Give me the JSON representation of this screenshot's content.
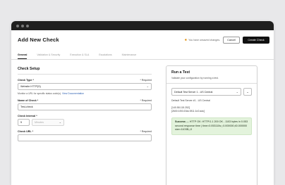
{
  "header": {
    "title": "Add New Check",
    "unsaved_text": "You have unsaved changes.",
    "cancel_label": "Cancel",
    "create_label": "Create Check"
  },
  "tabs": [
    {
      "label": "General",
      "active": true
    },
    {
      "label": "Validation & Security",
      "active": false
    },
    {
      "label": "Execution & SLA",
      "active": false
    },
    {
      "label": "Escalations",
      "active": false
    },
    {
      "label": "Maintenance",
      "active": false
    }
  ],
  "setup": {
    "title": "Check Setup",
    "check_type_label": "Check Type *",
    "check_type_required": "* Required",
    "check_type_value": "Website HTTP(S)",
    "check_type_help": "Monitor a URL for specific status code(s).",
    "check_type_help_link": "View Documentation",
    "name_label": "Name of Check *",
    "name_required": "* Required",
    "name_value": "Test-check",
    "interval_label": "Check Interval *",
    "interval_value": "5",
    "interval_unit": "Minutes",
    "url_label": "Check URL *",
    "url_required": "* Required"
  },
  "run_test": {
    "title": "Run a Test",
    "subtitle": "Validate your configuration by running a test.",
    "server_value": "Default Test Server 1 - US Central",
    "server_name": "Default Test Server #1 - US Central",
    "server_ipv4": "[140.58.115.252]",
    "server_ipv6": "[2600:1f00:20dc:5f11:1e2:adc]",
    "result_status": "Success",
    "result_text": " — HTTP OK: HTTP/1.1 200 OK - 1103 bytes in 0.053 second response time | time=0.053110s;;;0.000000;40.000000 size=1103B;;;0"
  }
}
